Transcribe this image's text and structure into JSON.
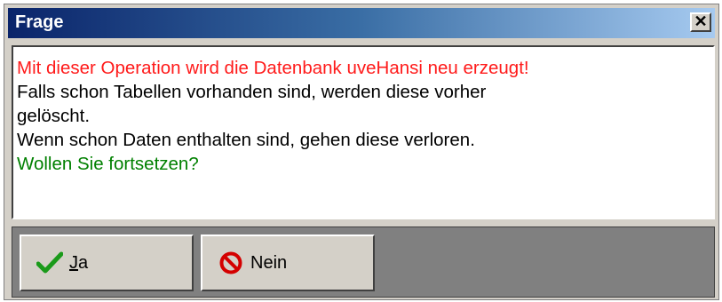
{
  "dialog": {
    "title": "Frage",
    "close_glyph": "✕"
  },
  "message": {
    "lines": [
      {
        "text": "Mit dieser Operation wird die Datenbank uveHansi neu erzeugt!",
        "color": "#ff1a1a"
      },
      {
        "text": "Falls schon Tabellen vorhanden sind, werden diese vorher",
        "color": "#000000"
      },
      {
        "text": "gelöscht.",
        "color": "#000000"
      },
      {
        "text": "Wenn schon Daten enthalten sind, gehen diese verloren.",
        "color": "#000000"
      },
      {
        "text": "Wollen Sie fortsetzen?",
        "color": "#008000"
      }
    ]
  },
  "buttons": {
    "yes": {
      "accel": "J",
      "rest": "a",
      "icon": "checkmark-icon"
    },
    "no": {
      "label": "Nein",
      "icon": "no-entry-icon"
    }
  }
}
